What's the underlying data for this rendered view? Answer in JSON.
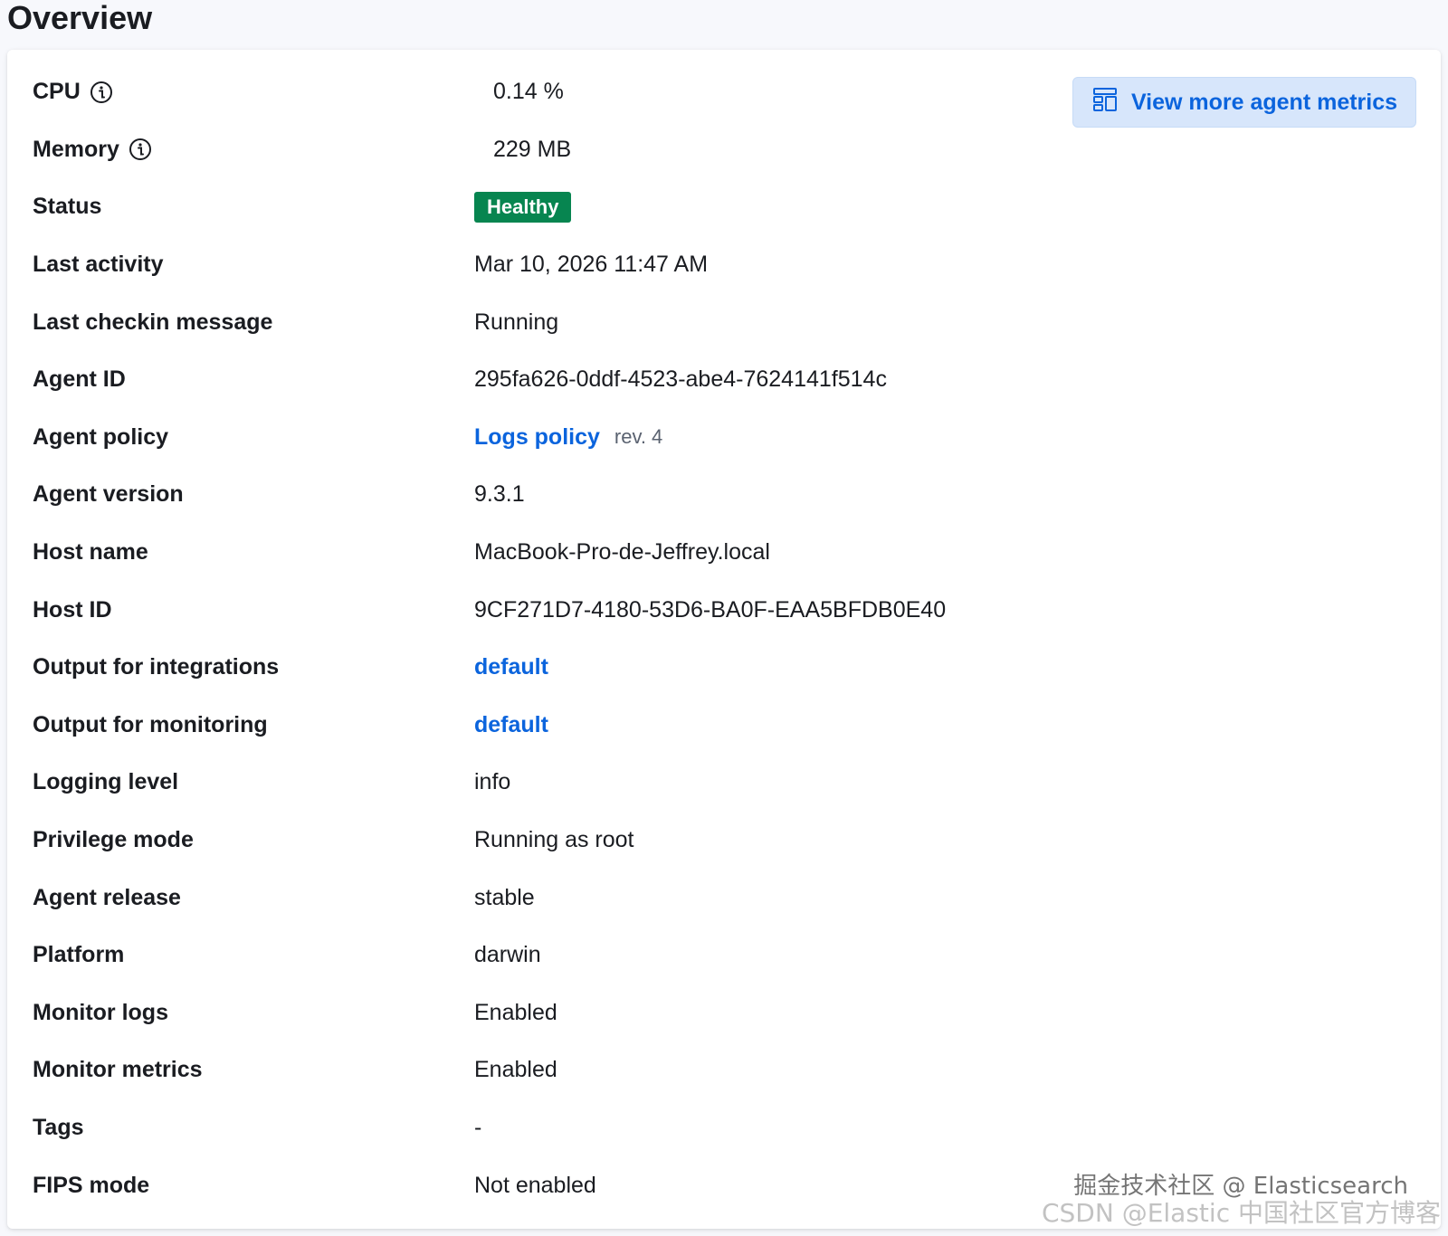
{
  "page": {
    "title": "Overview"
  },
  "actions": {
    "view_metrics": "View more agent metrics"
  },
  "rows": [
    {
      "label": "CPU",
      "value": "0.14 %"
    },
    {
      "label": "Memory",
      "value": "229 MB"
    },
    {
      "label": "Status",
      "value": "Healthy"
    },
    {
      "label": "Last activity",
      "value": "Mar 10, 2026 11:47 AM"
    },
    {
      "label": "Last checkin message",
      "value": "Running"
    },
    {
      "label": "Agent ID",
      "value": "295fa626-0ddf-4523-abe4-7624141f514c"
    },
    {
      "label": "Agent policy",
      "value": "Logs policy",
      "secondary": "rev. 4"
    },
    {
      "label": "Agent version",
      "value": "9.3.1"
    },
    {
      "label": "Host name",
      "value": "MacBook-Pro-de-Jeffrey.local"
    },
    {
      "label": "Host ID",
      "value": "9CF271D7-4180-53D6-BA0F-EAA5BFDB0E40"
    },
    {
      "label": "Output for integrations",
      "value": "default"
    },
    {
      "label": "Output for monitoring",
      "value": "default"
    },
    {
      "label": "Logging level",
      "value": "info"
    },
    {
      "label": "Privilege mode",
      "value": "Running as root"
    },
    {
      "label": "Agent release",
      "value": "stable"
    },
    {
      "label": "Platform",
      "value": "darwin"
    },
    {
      "label": "Monitor logs",
      "value": "Enabled"
    },
    {
      "label": "Monitor metrics",
      "value": "Enabled"
    },
    {
      "label": "Tags",
      "value": "-"
    },
    {
      "label": "FIPS mode",
      "value": "Not enabled"
    }
  ],
  "watermark": {
    "line1": "掘金技术社区 @ Elasticsearch",
    "line2": "CSDN @Elastic 中国社区官方博客"
  },
  "colors": {
    "badge_green": "#078550",
    "link_blue": "#0b64dd",
    "button_bg": "#d7e6fb"
  },
  "icons": {
    "info": "info-icon",
    "metrics": "dashboard-icon"
  }
}
